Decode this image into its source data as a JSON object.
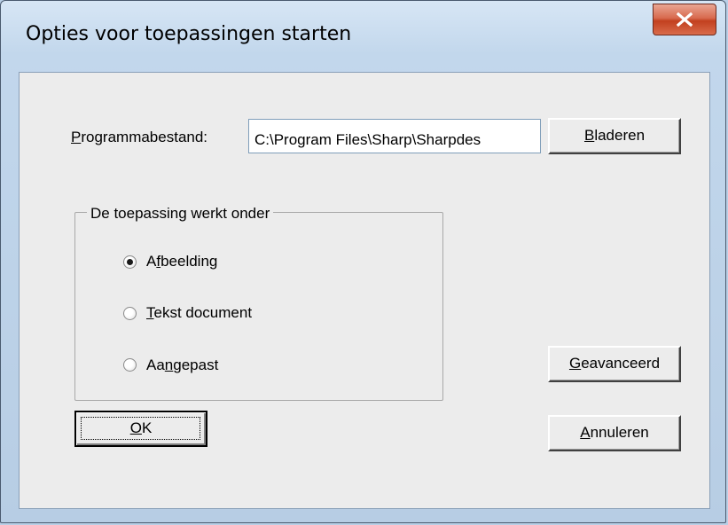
{
  "window": {
    "title": "Opties voor toepassingen starten"
  },
  "program": {
    "label_mnemonic": "P",
    "label_rest": "rogrammabestand:",
    "path_value": "C:\\Program Files\\Sharp\\Sharpdes"
  },
  "buttons": {
    "browse": {
      "mnemonic": "B",
      "rest": "laderen"
    },
    "advanced": {
      "mnemonic": "G",
      "rest": "eavanceerd"
    },
    "ok": {
      "mnemonic": "O",
      "rest": "K"
    },
    "cancel": {
      "mnemonic": "A",
      "rest": "nnuleren"
    }
  },
  "group": {
    "label": "De toepassing werkt onder",
    "options": [
      {
        "pre": "A",
        "mnemonic": "f",
        "post": "beelding",
        "selected": true
      },
      {
        "pre": "",
        "mnemonic": "T",
        "post": "ekst document",
        "selected": false
      },
      {
        "pre": "Aa",
        "mnemonic": "n",
        "post": "gepast",
        "selected": false
      }
    ]
  },
  "colors": {
    "close_button": "#c2401f",
    "dialog_background": "#ececec",
    "frame": "#c2d7ec"
  }
}
